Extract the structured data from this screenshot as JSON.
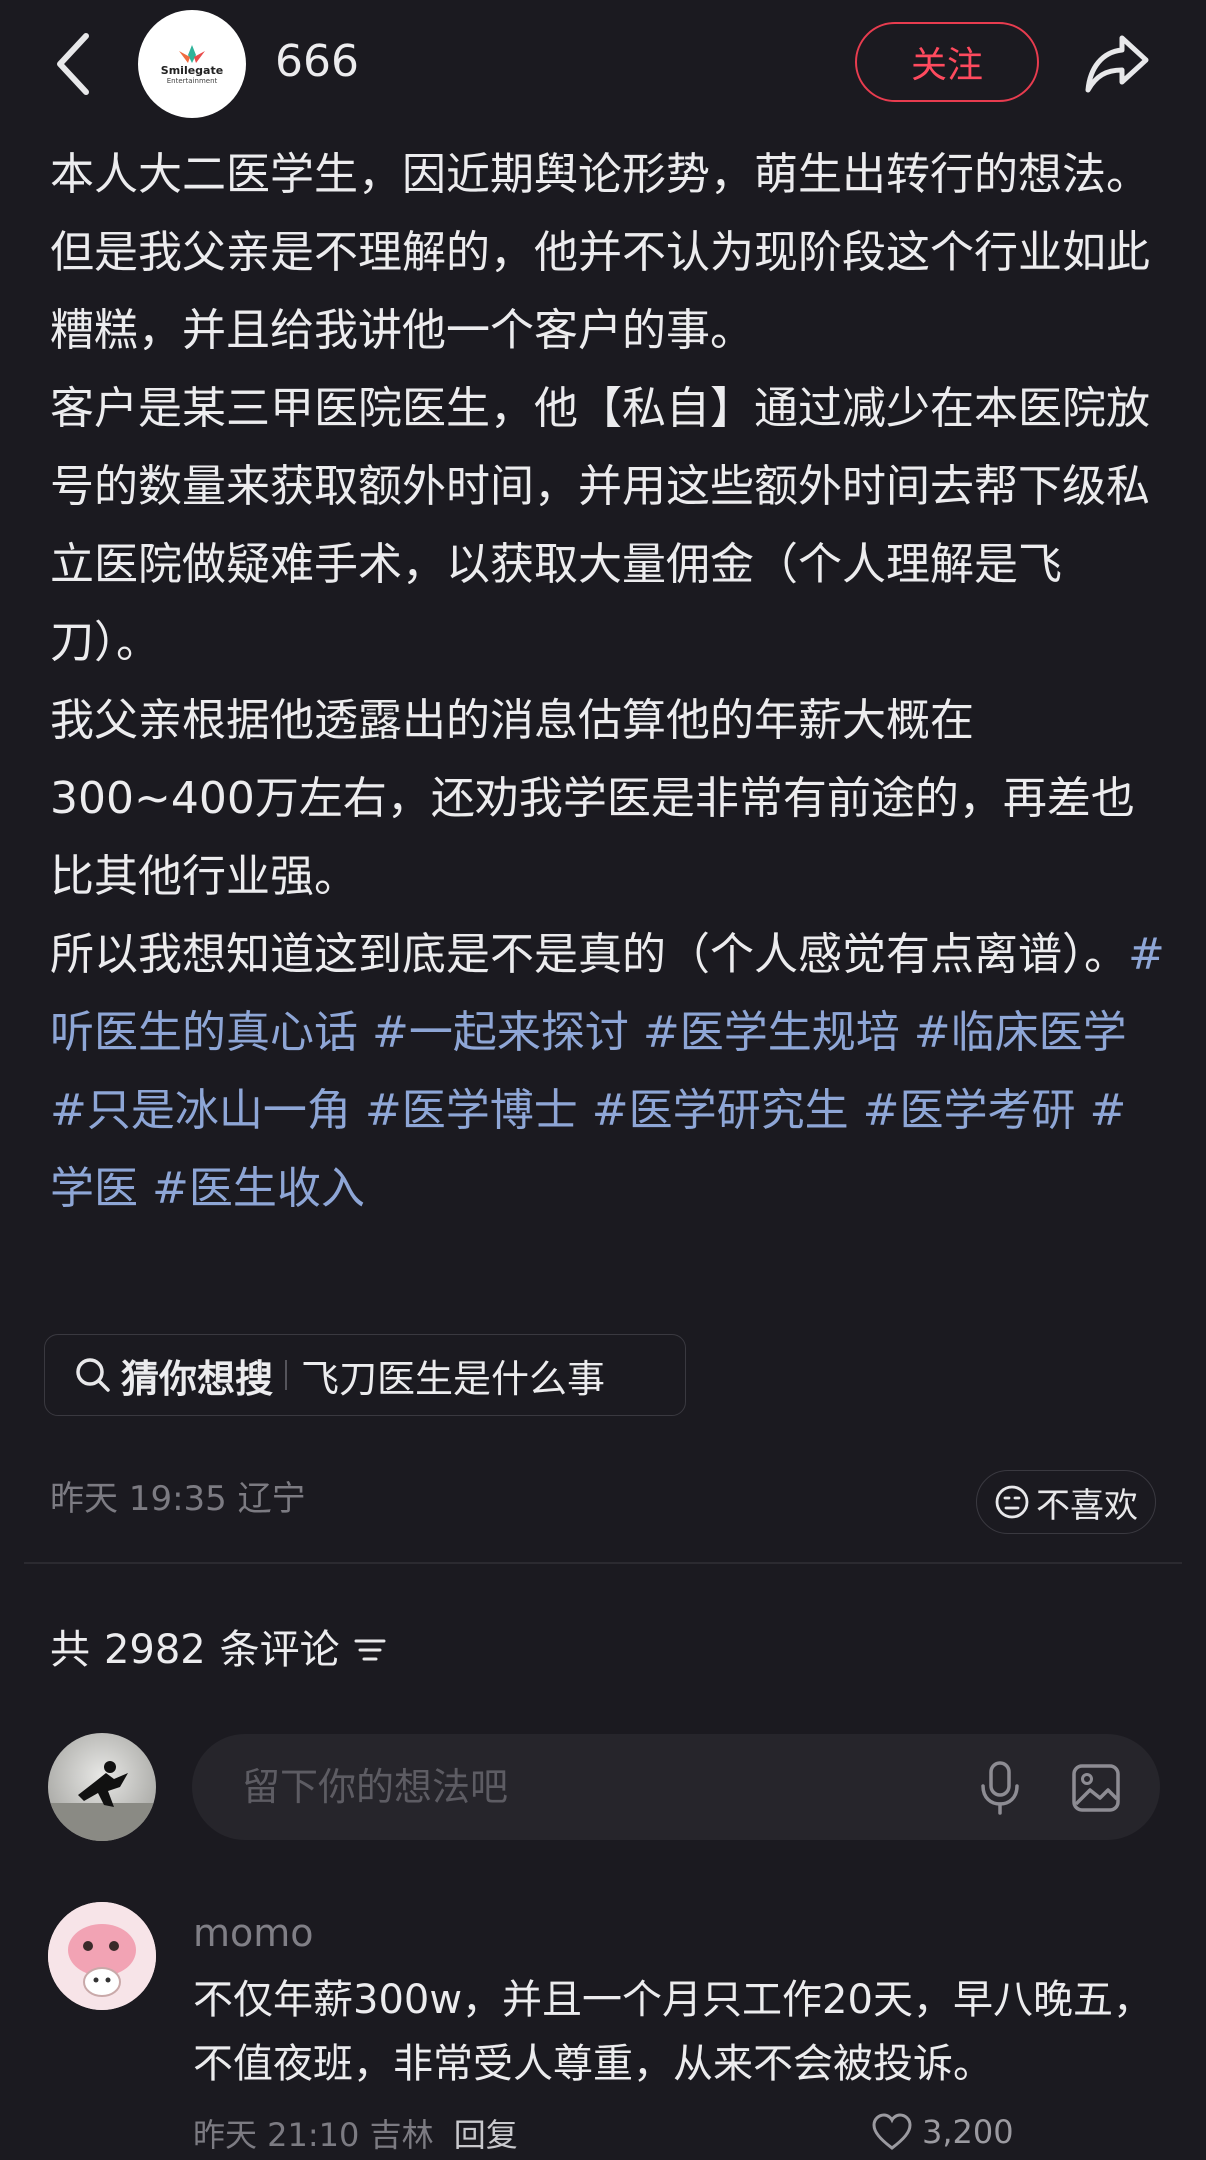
{
  "header": {
    "author_name": "666",
    "avatar_logo_text": "Smilegate",
    "avatar_logo_subtext": "Entertainment",
    "follow_label": "关注"
  },
  "post": {
    "paragraphs": [
      "本人大二医学生，因近期舆论形势，萌生出转行的想法。",
      "但是我父亲是不理解的，他并不认为现阶段这个行业如此糟糕，并且给我讲他一个客户的事。",
      "客户是某三甲医院医生，他【私自】通过减少在本医院放号的数量来获取额外时间，并用这些额外时间去帮下级私立医院做疑难手术，以获取大量佣金（个人理解是飞刀）。",
      "我父亲根据他透露出的消息估算他的年薪大概在300~400万左右，还劝我学医是非常有前途的，再差也比其他行业强。",
      "所以我想知道这到底是不是真的（个人感觉有点离谱）。"
    ],
    "hashtags": [
      "#听医生的真心话",
      "#一起来探讨",
      "#医学生规培",
      "#临床医学",
      "#只是冰山一角",
      "#医学博士",
      "#医学研究生",
      "#医学考研",
      "#学医",
      "#医生收入"
    ]
  },
  "suggest": {
    "prefix": "猜你想搜",
    "query": "飞刀医生是什么事"
  },
  "meta": {
    "time_location": "昨天 19:35 辽宁",
    "dislike_label": "不喜欢"
  },
  "comments_header": {
    "prefix": "共",
    "count": "2982",
    "suffix": "条评论"
  },
  "comment_input": {
    "placeholder": "留下你的想法吧"
  },
  "comments": [
    {
      "user": "momo",
      "text": "不仅年薪300w，并且一个月只工作20天，早八晚五，不值夜班，非常受人尊重，从来不会被投诉。",
      "time_location": "昨天 21:10 吉林",
      "reply_label": "回复",
      "likes": "3,200"
    }
  ],
  "colors": {
    "background": "#1b1a20",
    "follow_accent": "#ff4a5e",
    "hashtag": "#8ea6d6"
  }
}
